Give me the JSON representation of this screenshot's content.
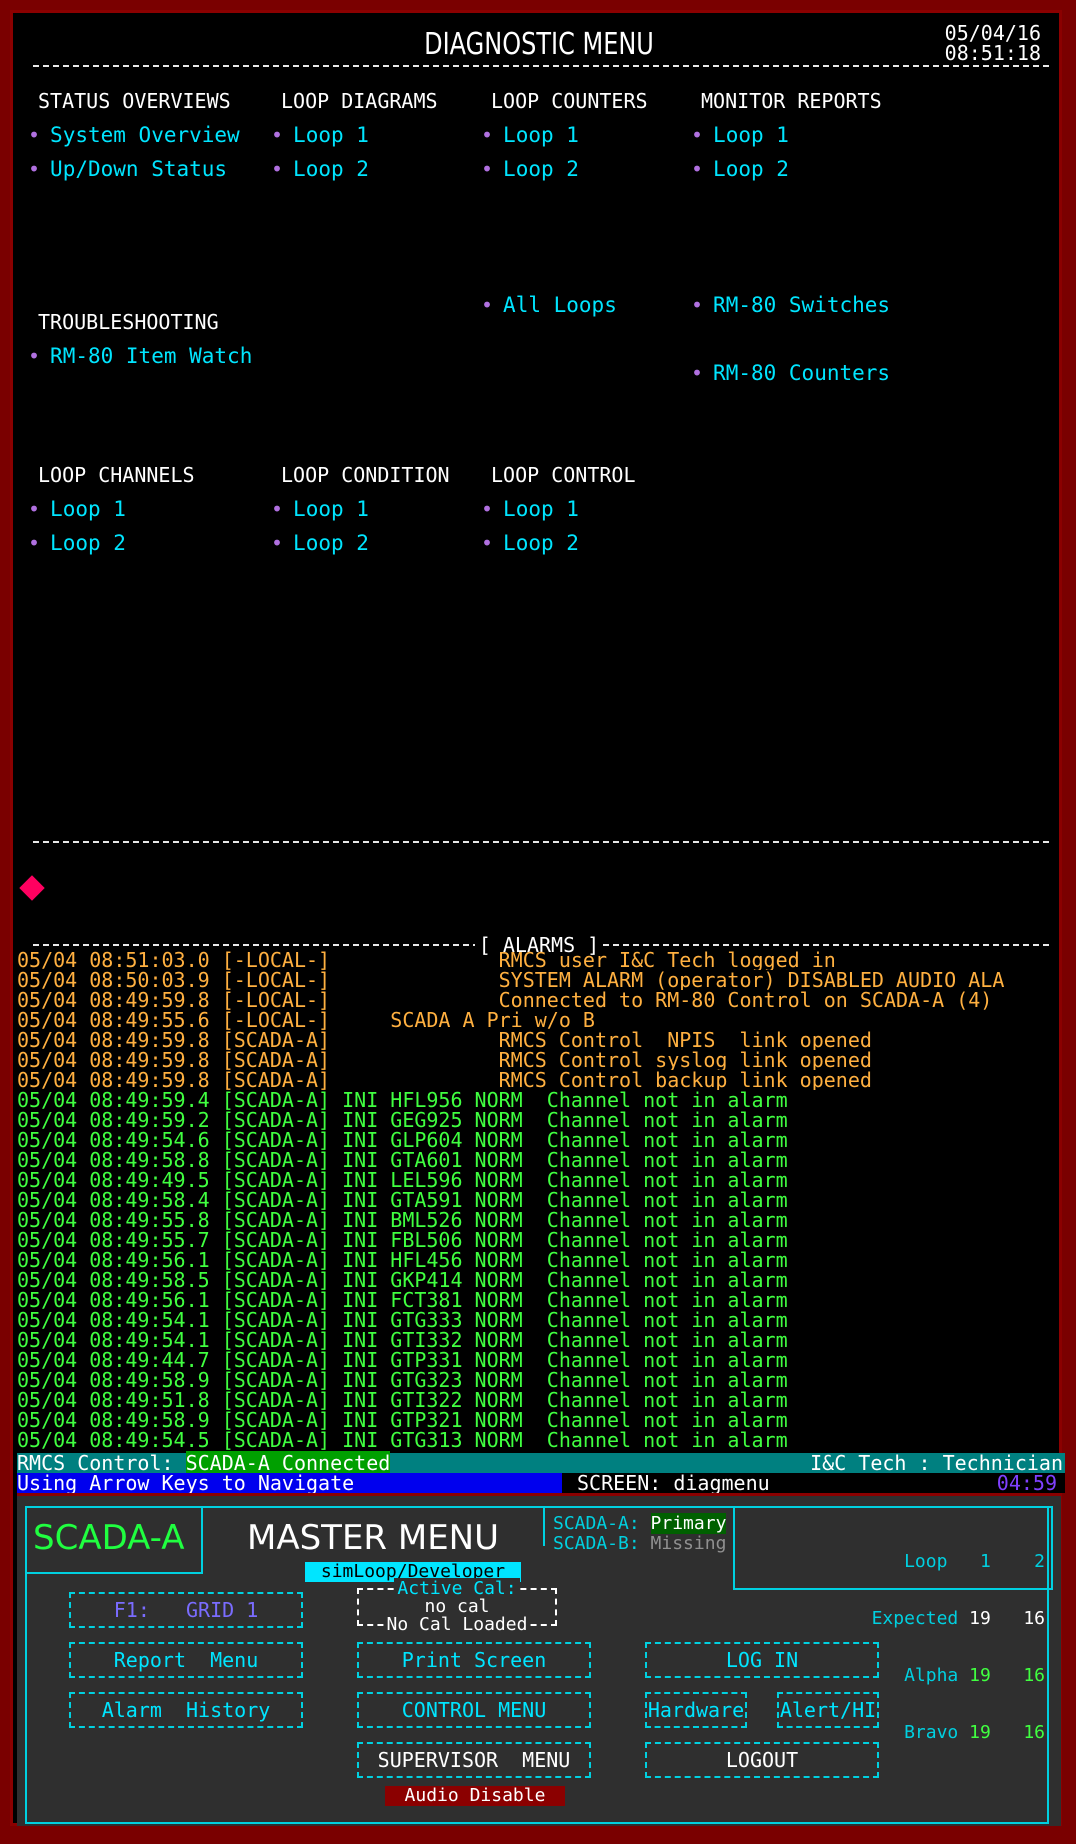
{
  "header": {
    "title": "DIAGNOSTIC MENU",
    "date": "05/04/16",
    "time": "08:51:18"
  },
  "menu": {
    "status_overviews": {
      "header": "STATUS OVERVIEWS",
      "items": [
        "System Overview",
        "Up/Down Status"
      ]
    },
    "loop_diagrams": {
      "header": "LOOP DIAGRAMS",
      "items": [
        "Loop 1",
        "Loop 2"
      ]
    },
    "loop_counters": {
      "header": "LOOP COUNTERS",
      "items": [
        "Loop 1",
        "Loop 2",
        "All Loops"
      ]
    },
    "monitor_reports": {
      "header": "MONITOR REPORTS",
      "items": [
        "Loop 1",
        "Loop 2",
        "RM-80 Switches",
        "RM-80 Counters"
      ]
    },
    "troubleshooting": {
      "header": "TROUBLESHOOTING",
      "items": [
        "RM-80 Item Watch"
      ]
    },
    "loop_channels": {
      "header": "LOOP CHANNELS",
      "items": [
        "Loop 1",
        "Loop 2"
      ]
    },
    "loop_condition": {
      "header": "LOOP CONDITION",
      "items": [
        "Loop 1",
        "Loop 2"
      ]
    },
    "loop_control": {
      "header": "LOOP CONTROL",
      "items": [
        "Loop 1",
        "Loop 2"
      ]
    }
  },
  "alarms": {
    "title": "[ ALARMS ]",
    "rows": [
      {
        "text": "05/04 08:51:03.0 [-LOCAL-]              RMCS user I&C Tech logged in",
        "color": "orange"
      },
      {
        "text": "05/04 08:50:03.9 [-LOCAL-]              SYSTEM ALARM (operator) DISABLED AUDIO ALA",
        "color": "orange"
      },
      {
        "text": "05/04 08:49:59.8 [-LOCAL-]              Connected to RM-80 Control on SCADA-A (4)",
        "color": "orange"
      },
      {
        "text": "05/04 08:49:55.6 [-LOCAL-]     SCADA A Pri w/o B",
        "color": "orange"
      },
      {
        "text": "05/04 08:49:59.8 [SCADA-A]              RMCS Control  NPIS  link opened",
        "color": "orange"
      },
      {
        "text": "05/04 08:49:59.8 [SCADA-A]              RMCS Control syslog link opened",
        "color": "orange"
      },
      {
        "text": "05/04 08:49:59.8 [SCADA-A]              RMCS Control backup link opened",
        "color": "orange"
      },
      {
        "text": "05/04 08:49:59.4 [SCADA-A] INI HFL956 NORM  Channel not in alarm",
        "color": "green"
      },
      {
        "text": "05/04 08:49:59.2 [SCADA-A] INI GEG925 NORM  Channel not in alarm",
        "color": "green"
      },
      {
        "text": "05/04 08:49:54.6 [SCADA-A] INI GLP604 NORM  Channel not in alarm",
        "color": "green"
      },
      {
        "text": "05/04 08:49:58.8 [SCADA-A] INI GTA601 NORM  Channel not in alarm",
        "color": "green"
      },
      {
        "text": "05/04 08:49:49.5 [SCADA-A] INI LEL596 NORM  Channel not in alarm",
        "color": "green"
      },
      {
        "text": "05/04 08:49:58.4 [SCADA-A] INI GTA591 NORM  Channel not in alarm",
        "color": "green"
      },
      {
        "text": "05/04 08:49:55.8 [SCADA-A] INI BML526 NORM  Channel not in alarm",
        "color": "green"
      },
      {
        "text": "05/04 08:49:55.7 [SCADA-A] INI FBL506 NORM  Channel not in alarm",
        "color": "green"
      },
      {
        "text": "05/04 08:49:56.1 [SCADA-A] INI HFL456 NORM  Channel not in alarm",
        "color": "green"
      },
      {
        "text": "05/04 08:49:58.5 [SCADA-A] INI GKP414 NORM  Channel not in alarm",
        "color": "green"
      },
      {
        "text": "05/04 08:49:56.1 [SCADA-A] INI FCT381 NORM  Channel not in alarm",
        "color": "green"
      },
      {
        "text": "05/04 08:49:54.1 [SCADA-A] INI GTG333 NORM  Channel not in alarm",
        "color": "green"
      },
      {
        "text": "05/04 08:49:54.1 [SCADA-A] INI GTI332 NORM  Channel not in alarm",
        "color": "green"
      },
      {
        "text": "05/04 08:49:44.7 [SCADA-A] INI GTP331 NORM  Channel not in alarm",
        "color": "green"
      },
      {
        "text": "05/04 08:49:58.9 [SCADA-A] INI GTG323 NORM  Channel not in alarm",
        "color": "green"
      },
      {
        "text": "05/04 08:49:51.8 [SCADA-A] INI GTI322 NORM  Channel not in alarm",
        "color": "green"
      },
      {
        "text": "05/04 08:49:58.9 [SCADA-A] INI GTP321 NORM  Channel not in alarm",
        "color": "green"
      },
      {
        "text": "05/04 08:49:54.5 [SCADA-A] INI GTG313 NORM  Channel not in alarm",
        "color": "green"
      }
    ]
  },
  "status_bar": {
    "rmcs_label": "RMCS Control: ",
    "rmcs_value": "SCADA-A Connected",
    "user": "I&C Tech : Technician",
    "nav_hint": "Using Arrow Keys to Navigate",
    "screen": "SCREEN: diagmenu",
    "timer": "04:59"
  },
  "master": {
    "station": "SCADA-A",
    "title": "MASTER MENU",
    "subtitle": "simLoop/Developer",
    "scada_a_label": "SCADA-A:",
    "scada_a_value": "Primary",
    "scada_b_label": "SCADA-B:",
    "scada_b_value": "Missing",
    "loop_table": {
      "loop_label": "Loop",
      "loop1": "1",
      "loop2": "2",
      "expected_label": "Expected",
      "expected1": "19",
      "expected2": "16",
      "alpha_label": "Alpha",
      "alpha1": "19",
      "alpha2": "16",
      "bravo_label": "Bravo",
      "bravo1": "19",
      "bravo2": "16"
    },
    "active_cal": {
      "label": "Active Cal:",
      "value": "no cal",
      "status": "No Cal Loaded"
    },
    "buttons": {
      "f1": "F1:   GRID 1",
      "report": "Report  Menu",
      "alarm_history": "Alarm  History",
      "print_screen": "Print Screen",
      "control_menu": "CONTROL MENU",
      "supervisor_menu": "SUPERVISOR  MENU",
      "log_in": "LOG IN",
      "hardware": "Hardware",
      "alert": "Alert/HI",
      "logout": "LOGOUT"
    },
    "audio_disable": "Audio Disable"
  },
  "colors": {
    "cyan": "#00e5ff",
    "purple_dot": "#b070e0",
    "alarm_orange": "#ffb040",
    "alarm_green": "#40ff40",
    "frame_red": "#8b0000"
  }
}
